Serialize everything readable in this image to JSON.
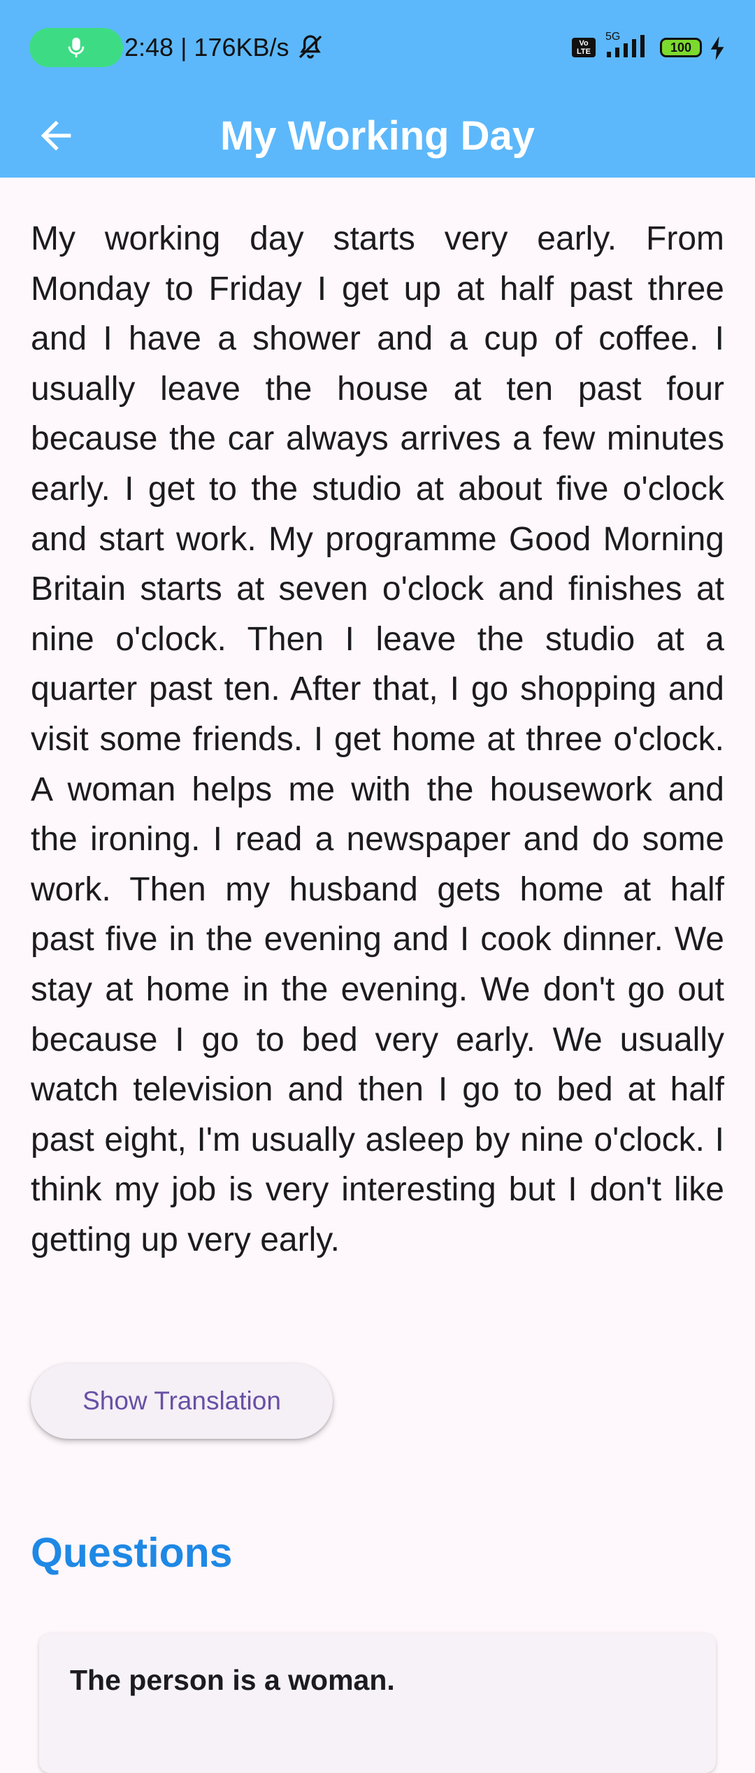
{
  "status_bar": {
    "time_and_speed": "2:48 | 176KB/s",
    "network": "5G",
    "volte": "Vo LTE",
    "battery": "100",
    "icons": [
      "mic-icon",
      "mute-icon",
      "volte-icon",
      "signal-icon",
      "battery-icon",
      "charging-icon"
    ],
    "mic_pill_color": "#3DDC84"
  },
  "app_bar": {
    "title": "My Working Day",
    "back_icon": "arrow-left-icon",
    "background": "#5CB8FB"
  },
  "story": {
    "text": "My working day starts very early. From Monday to Friday I get up at half past three and I have a shower and a cup of coffee. I usually leave the house at ten past four because the car always arrives a few minutes early. I get to the studio at about five o'clock and start work. My programme Good Morning Britain starts at seven o'clock and finishes at nine o'clock. Then I leave the studio at a quarter past ten. After that, I go shopping and visit some friends. I get home at three o'clock. A woman helps me with the housework and the ironing. I read a newspaper and do some work. Then my husband gets home at half past five in the evening and I cook dinner. We stay at home in the evening. We don't go out because I go to bed very early. We usually watch television and then I go to bed at half past eight, I'm usually asleep by nine o'clock. I think my job is very interesting but I don't like getting up very early."
  },
  "translation_button": {
    "label": "Show Translation",
    "color": "#6750A4"
  },
  "questions": {
    "heading": "Questions",
    "heading_color": "#1E88E5",
    "items": [
      {
        "text": "The person is a woman."
      }
    ]
  }
}
